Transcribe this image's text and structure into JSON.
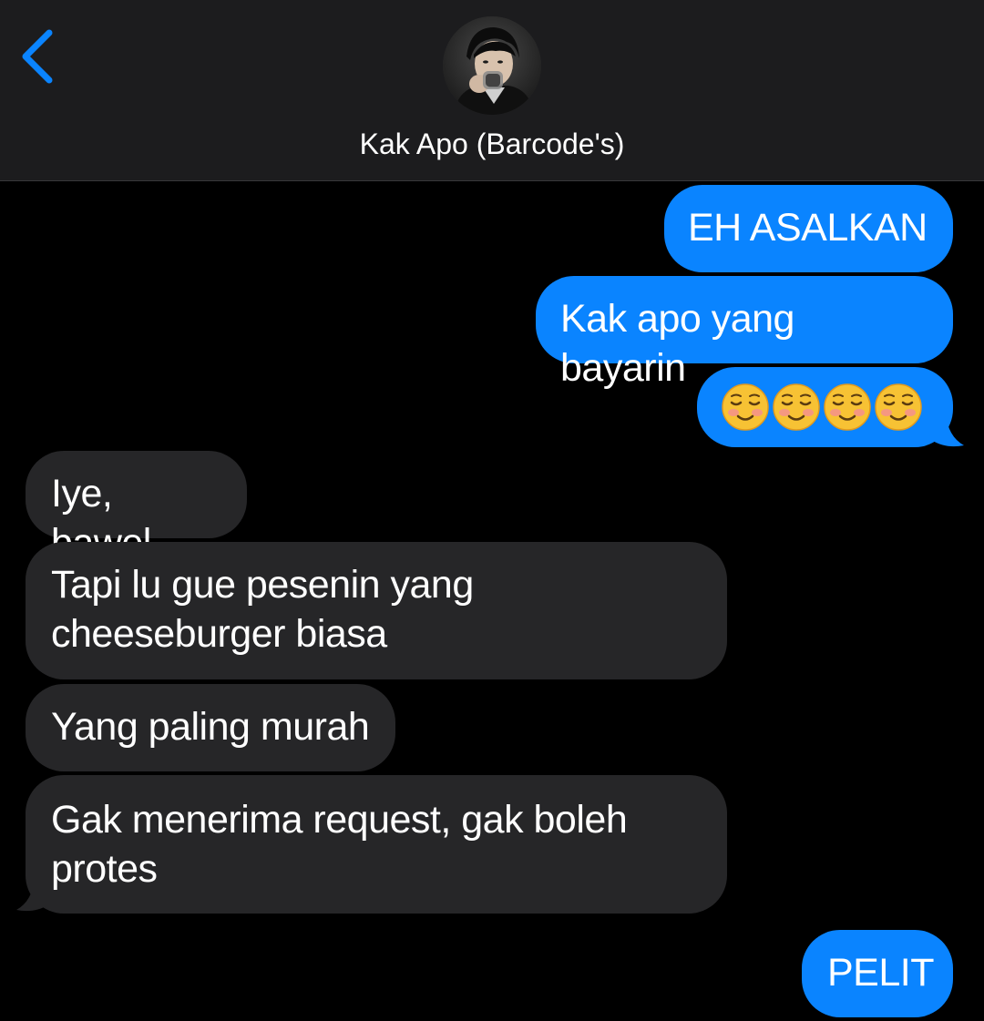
{
  "header": {
    "contact_name": "Kak Apo (Barcode's)",
    "accent_color": "#0a84ff",
    "back_icon": "chevron-left-icon",
    "avatar": "contact-avatar-photo"
  },
  "messages": [
    {
      "direction": "outgoing",
      "text": "EH ASALKAN"
    },
    {
      "direction": "outgoing",
      "text": "Kak apo yang bayarin"
    },
    {
      "direction": "outgoing",
      "emoji": "smiling-face-icon",
      "count": 4
    },
    {
      "direction": "incoming",
      "text": "Iye, bawel"
    },
    {
      "direction": "incoming",
      "line1": "Tapi lu gue pesenin yang",
      "line2": "cheeseburger biasa"
    },
    {
      "direction": "incoming",
      "text": "Yang paling murah"
    },
    {
      "direction": "incoming",
      "line1": "Gak menerima request, gak boleh",
      "line2": "protes"
    },
    {
      "direction": "outgoing",
      "text": "PELIT"
    }
  ],
  "colors": {
    "outgoing_bubble": "#0a84ff",
    "incoming_bubble": "#262628",
    "header_background": "#1c1c1e",
    "background": "#000000"
  }
}
